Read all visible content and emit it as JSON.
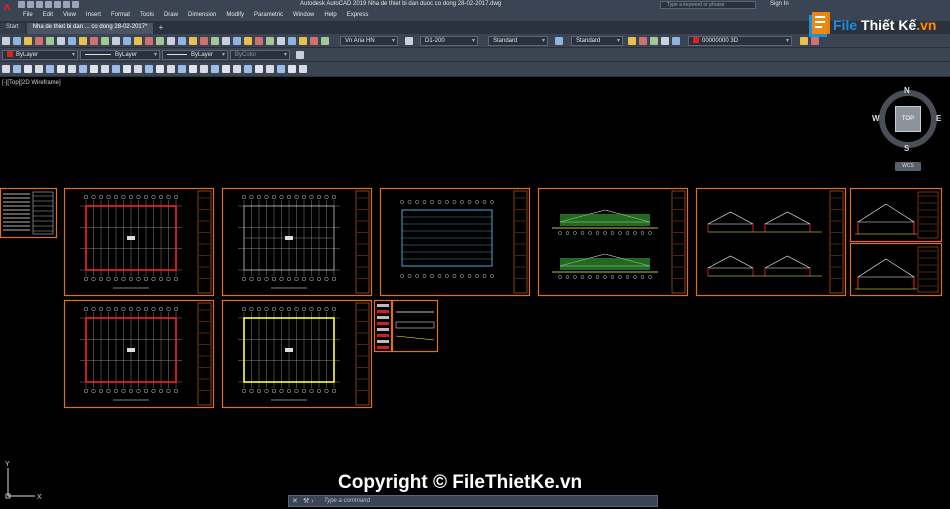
{
  "window": {
    "title": "Autodesk AutoCAD 2019    Nha de thiet bi dan duoc co dong 28-02-2017.dwg",
    "app_icon_letter": "A",
    "search_placeholder": "Type a keyword or phrase",
    "sign_in": "Sign In"
  },
  "menu": [
    "File",
    "Edit",
    "View",
    "Insert",
    "Format",
    "Tools",
    "Draw",
    "Dimension",
    "Modify",
    "Parametric",
    "Window",
    "Help",
    "Express"
  ],
  "tabs": [
    {
      "label": "Start",
      "active": false
    },
    {
      "label": "Nha de thiet bi dan ... co dong 28-02-2017*",
      "active": true
    }
  ],
  "tabs_add": "+",
  "toolbar": {
    "text_style": "Vn Aria HN",
    "dim_style": "D1-200",
    "table_style": "Standard",
    "multileader_style": "Standard",
    "layer": "00000000 3D",
    "layer_color": "#e02020"
  },
  "properties": {
    "color": "ByLayer",
    "linetype": "ByLayer",
    "lineweight": "ByLayer",
    "plotstyle": "ByColor"
  },
  "viewport": {
    "label": "[-][Top][2D Wireframe]"
  },
  "viewcube": {
    "face": "TOP",
    "n": "N",
    "s": "S",
    "e": "E",
    "w": "W",
    "wcs": "WCS"
  },
  "ucs": {
    "x": "X",
    "y": "Y"
  },
  "command": {
    "placeholder": "Type a command"
  },
  "watermark": {
    "copyright": "Copyright © FileThietKe.vn",
    "logo_file": "File",
    "logo_rest": " Thiết Kế",
    "logo_dot": ".vn"
  },
  "colors": {
    "frame": "#e07020",
    "model_bg": "#000000",
    "grid": "#ffffff",
    "highlight_red": "#ff2020",
    "highlight_yellow": "#ffff40",
    "roof_cyan": "#60d0ff",
    "green": "#40c040"
  }
}
